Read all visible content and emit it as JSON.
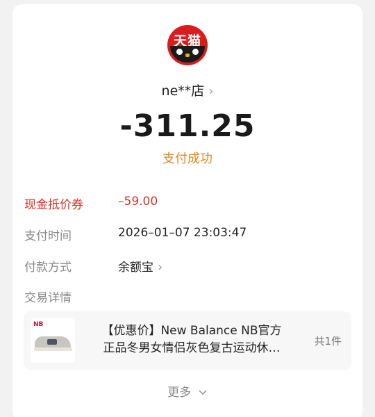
{
  "store": {
    "logo_text": "天猫",
    "name": "ne**店"
  },
  "payment": {
    "amount": "-311.25",
    "status": "支付成功"
  },
  "details": [
    {
      "label": "现金抵价券",
      "value": "–59.00",
      "highlight": true
    },
    {
      "label": "支付时间",
      "value": "2026–01–07 23:03:47",
      "highlight": false
    },
    {
      "label": "付款方式",
      "value": "余额宝",
      "highlight": false
    }
  ],
  "transaction": {
    "label": "交易详情",
    "product": {
      "title_line1": "【优惠价】New Balance NB官方",
      "title_line2": "正品冬男女情侣灰色复古运动休…",
      "count": "共1件"
    }
  },
  "more_label": "更多",
  "colors": {
    "accent_red": "#d9342b",
    "status_orange": "#e08a2a",
    "tmall_red": "#d91d1d"
  }
}
